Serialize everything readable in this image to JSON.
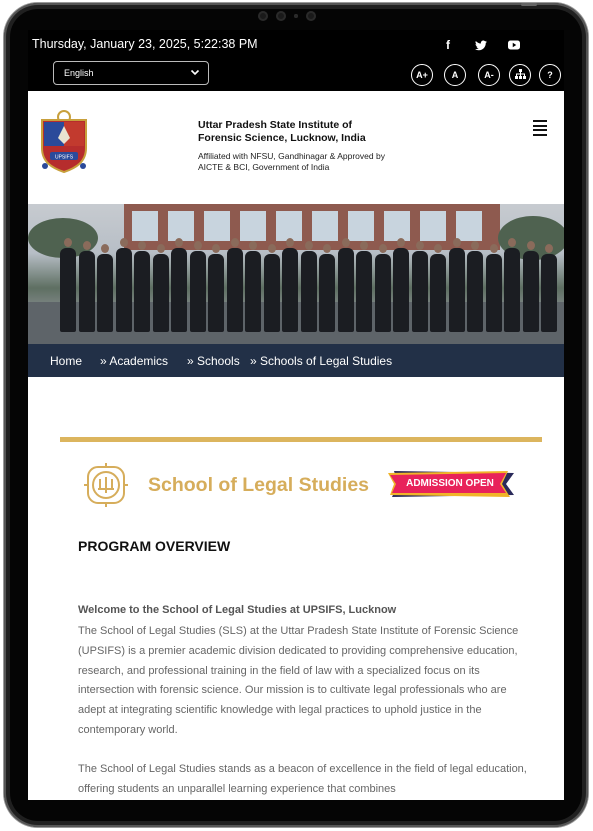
{
  "topbar": {
    "datetime": "Thursday, January 23, 2025, 5:22:38 PM",
    "social": [
      {
        "icon": "facebook-icon",
        "glyph": "f"
      },
      {
        "icon": "twitter-icon",
        "glyph": "𝕥"
      },
      {
        "icon": "youtube-icon",
        "glyph": "▶"
      }
    ],
    "language": "English",
    "accessibility": [
      {
        "label": "A+",
        "icon": "increase-font-icon"
      },
      {
        "label": "A",
        "icon": "default-font-icon"
      },
      {
        "label": "A-",
        "icon": "decrease-font-icon"
      },
      {
        "label": "",
        "icon": "sitemap-icon"
      },
      {
        "label": "?",
        "icon": "help-icon"
      }
    ]
  },
  "header": {
    "institute_name": "Uttar Pradesh State Institute of Forensic Science, Lucknow, India",
    "affiliation": "Affiliated with NFSU, Gandhinagar & Approved by AICTE & BCI, Government of India",
    "logo_text": "UPSIFS"
  },
  "breadcrumb": [
    "Home",
    "» Academics",
    "» Schools",
    "» Schools of Legal Studies"
  ],
  "content": {
    "school_title": "School of Legal Studies",
    "admission_badge": "ADMISSION OPEN",
    "section_heading": "PROGRAM OVERVIEW",
    "welcome": "Welcome to the School of Legal Studies at UPSIFS, Lucknow",
    "paragraph_1": "The School of Legal Studies (SLS) at the Uttar Pradesh State Institute of Forensic Science (UPSIFS) is a premier academic division dedicated to providing comprehensive education, research, and professional training in the field of law with a specialized focus on its intersection with forensic science. Our mission is to cultivate legal professionals who are adept at integrating scientific knowledge with legal practices to uphold justice in the contemporary world.",
    "paragraph_2": "The School of Legal Studies stands as a beacon of excellence in the field of legal education, offering students an unparallel learning experience that combines"
  },
  "colors": {
    "topbar": "#000000",
    "breadcrumb": "#223047",
    "gold": "#dcb55e",
    "badge": "#e8225a"
  }
}
